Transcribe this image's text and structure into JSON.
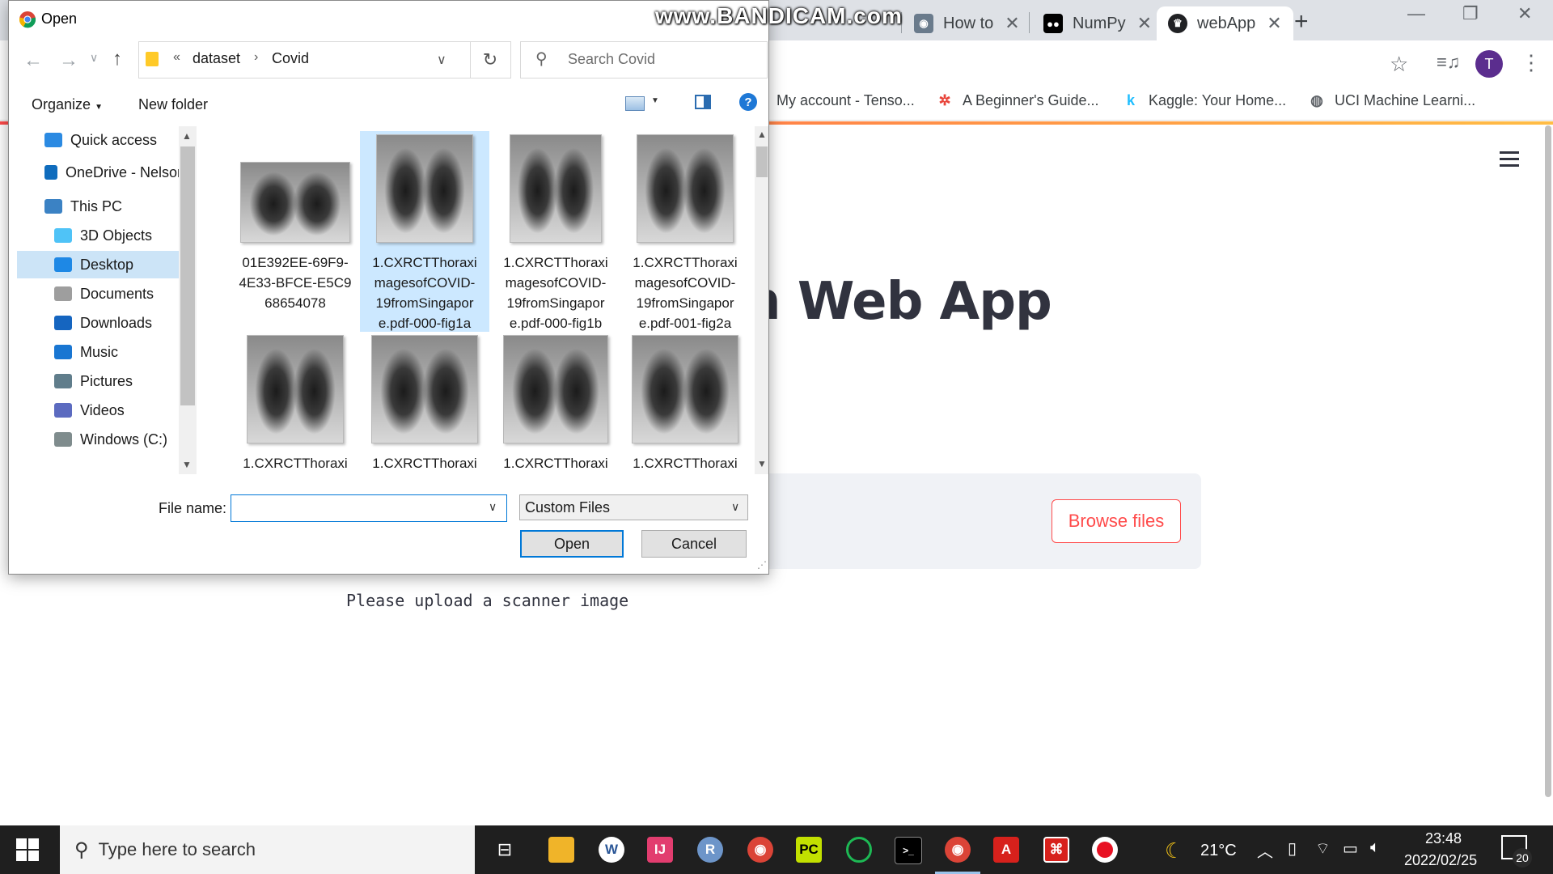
{
  "browser": {
    "tabs": [
      {
        "label": "How to",
        "icon": "user-photo-icon"
      },
      {
        "label": "NumPy",
        "icon": "medium-icon"
      },
      {
        "label": "webApp",
        "icon": "streamlit-crown-icon",
        "active": true
      }
    ],
    "bookmarks": [
      {
        "label": "My account - Tenso..."
      },
      {
        "label": "A Beginner's Guide..."
      },
      {
        "label": "Kaggle: Your Home..."
      },
      {
        "label": "UCI Machine Learni..."
      }
    ],
    "avatar_letter": "T"
  },
  "app": {
    "title": "n Web App",
    "browse_label": "Browse files",
    "upload_message": "Please upload a scanner image",
    "accent_color": "#ff4b4b"
  },
  "watermark": "www.BANDICAM.com",
  "dialog": {
    "title": "Open",
    "path": [
      "«",
      "dataset",
      "Covid"
    ],
    "search_placeholder": "Search Covid",
    "organize_label": "Organize",
    "new_folder_label": "New folder",
    "nav_items": [
      {
        "label": "Quick access",
        "icon": "star-icon",
        "indent": 1
      },
      {
        "label": "OneDrive - Nelson",
        "icon": "cloud-icon",
        "indent": 1
      },
      {
        "label": "This PC",
        "icon": "computer-icon",
        "indent": 1
      },
      {
        "label": "3D Objects",
        "icon": "cube-icon",
        "indent": 2
      },
      {
        "label": "Desktop",
        "icon": "desktop-icon",
        "indent": 2,
        "selected": true
      },
      {
        "label": "Documents",
        "icon": "document-icon",
        "indent": 2
      },
      {
        "label": "Downloads",
        "icon": "download-icon",
        "indent": 2
      },
      {
        "label": "Music",
        "icon": "music-icon",
        "indent": 2
      },
      {
        "label": "Pictures",
        "icon": "picture-icon",
        "indent": 2
      },
      {
        "label": "Videos",
        "icon": "video-icon",
        "indent": 2
      },
      {
        "label": "Windows (C:)",
        "icon": "drive-icon",
        "indent": 2
      }
    ],
    "files": [
      {
        "name_lines": [
          "01E392EE-69F9-",
          "4E33-BFCE-E5C9",
          "68654078"
        ]
      },
      {
        "name_lines": [
          "1.CXRCTThoraxi",
          "magesofCOVID-",
          "19fromSingapor",
          "e.pdf-000-fig1a"
        ],
        "selected": true
      },
      {
        "name_lines": [
          "1.CXRCTThoraxi",
          "magesofCOVID-",
          "19fromSingapor",
          "e.pdf-000-fig1b"
        ]
      },
      {
        "name_lines": [
          "1.CXRCTThoraxi",
          "magesofCOVID-",
          "19fromSingapor",
          "e.pdf-001-fig2a"
        ]
      },
      {
        "name_lines": [
          "1.CXRCTThoraxi"
        ]
      },
      {
        "name_lines": [
          "1.CXRCTThoraxi"
        ]
      },
      {
        "name_lines": [
          "1.CXRCTThoraxi"
        ]
      },
      {
        "name_lines": [
          "1.CXRCTThoraxi"
        ]
      }
    ],
    "file_name_label": "File name:",
    "file_name_value": "",
    "file_type": "Custom Files",
    "open_label": "Open",
    "cancel_label": "Cancel"
  },
  "taskbar": {
    "search_placeholder": "Type here to search",
    "weather": "21°C",
    "time": "23:48",
    "date": "2022/02/25",
    "notification_count": "20"
  }
}
